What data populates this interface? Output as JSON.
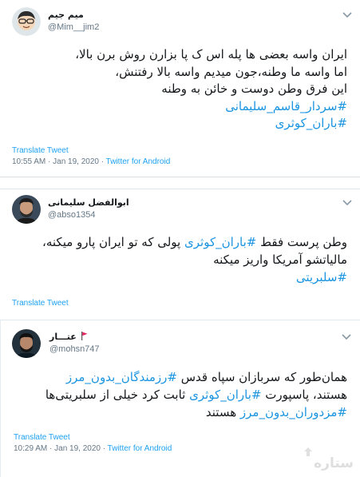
{
  "tweets": [
    {
      "name": "میم جیم",
      "handle": "@Mim__jim2",
      "lines": [
        {
          "text": "ایران واسه بعضی ها پله اس ک پا بزارن روش برن بالا،",
          "tag": false
        },
        {
          "text": "اما واسه ما وطنه،جون میدیم واسه بالا رفتنش،",
          "tag": false
        },
        {
          "text": "این فرق وطن دوست و خائن به وطنه",
          "tag": false
        },
        {
          "text": "#سردار_قاسم_سلیمانی",
          "tag": true
        },
        {
          "text": "#باران_کوثری",
          "tag": true
        }
      ],
      "translate": "Translate Tweet",
      "time": "10:55 AM · Jan 19, 2020 · ",
      "source": "Twitter for Android"
    },
    {
      "name": "ابوالفضل سلیمانی",
      "handle": "@abso1354",
      "line1_hashtag": "#باران_کوثری",
      "line1_pre": "وطن پرست فقط ",
      "line1_post": " پولی که تو ایران پارو میکنه،",
      "line2": "مالیاتشو آمریکا واریز میکنه",
      "line3_hashtag": "#سلبریتی",
      "translate": "Translate Tweet"
    },
    {
      "name": "عتـــار",
      "handle": "@mohsn747",
      "line1_pre": "همان‌طور که سربازان سپاه قدس ",
      "line1_hashtag": "#رزمندگان_بدون_مرز",
      "line2_pre": "هستند، پاسپورت ",
      "line2_hashtag": "#باران_کوثری",
      "line2_post": " ثابت کرد خیلی از سلبریتی‌ها",
      "line3_hashtag": "#مزدوران_بدون_مرز",
      "line3_post": " هستند",
      "translate": "Translate Tweet",
      "time": "10:29 AM · Jan 19, 2020 · ",
      "source": "Twitter for Android"
    }
  ],
  "watermark_text": "ستاره",
  "colors": {
    "link": "#1da1f2",
    "hashtag": "#1b95e0",
    "muted": "#657786",
    "flag": "#e0245e"
  },
  "icons": [
    "avatar",
    "chevron-down-icon",
    "red-flag-icon",
    "watermark-logo"
  ]
}
